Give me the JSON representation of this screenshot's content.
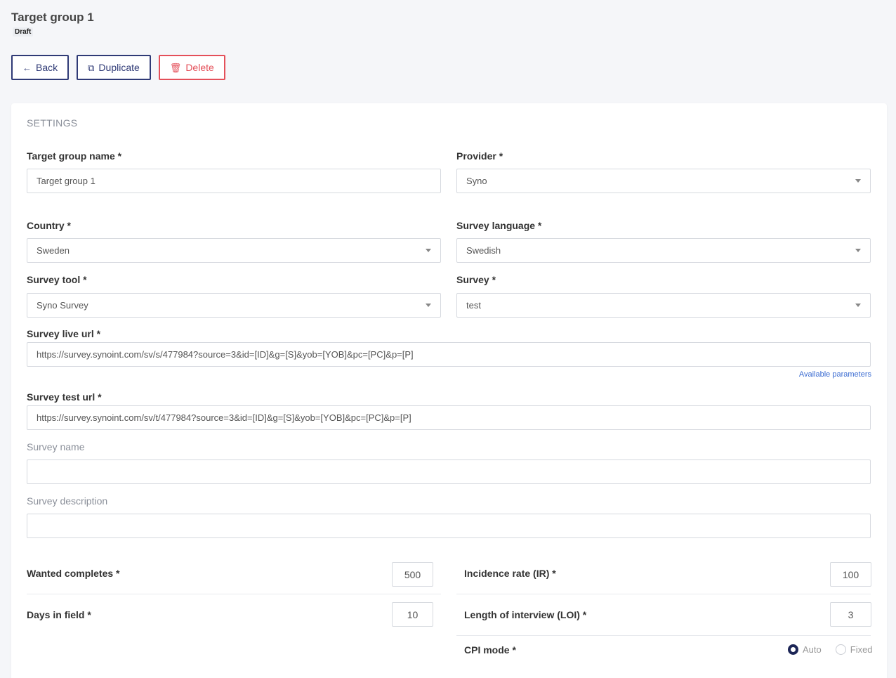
{
  "header": {
    "title": "Target group 1",
    "status": "Draft"
  },
  "toolbar": {
    "back_label": "Back",
    "duplicate_label": "Duplicate",
    "delete_label": "Delete"
  },
  "settings": {
    "section_title": "SETTINGS",
    "target_group_name": {
      "label": "Target group name *",
      "value": "Target group 1"
    },
    "provider": {
      "label": "Provider *",
      "value": "Syno"
    },
    "country": {
      "label": "Country *",
      "value": "Sweden"
    },
    "survey_language": {
      "label": "Survey language *",
      "value": "Swedish"
    },
    "survey_tool": {
      "label": "Survey tool *",
      "value": "Syno Survey"
    },
    "survey": {
      "label": "Survey *",
      "value": "test"
    },
    "survey_live_url": {
      "label": "Survey live url *",
      "value": "https://survey.synoint.com/sv/s/477984?source=3&id=[ID]&g=[S]&yob=[YOB]&pc=[PC]&p=[P]"
    },
    "available_parameters": "Available parameters",
    "survey_test_url": {
      "label": "Survey test url *",
      "value": "https://survey.synoint.com/sv/t/477984?source=3&id=[ID]&g=[S]&yob=[YOB]&pc=[PC]&p=[P]"
    },
    "survey_name": {
      "label": "Survey name",
      "value": ""
    },
    "survey_description": {
      "label": "Survey description",
      "value": ""
    },
    "wanted_completes": {
      "label": "Wanted completes *",
      "value": "500"
    },
    "incidence_rate": {
      "label": "Incidence rate (IR) *",
      "value": "100"
    },
    "days_in_field": {
      "label": "Days in field *",
      "value": "10"
    },
    "length_of_interview": {
      "label": "Length of interview (LOI) *",
      "value": "3"
    },
    "cpi_mode": {
      "label": "CPI mode *",
      "options": [
        "Auto",
        "Fixed"
      ],
      "selected": "Auto"
    }
  }
}
